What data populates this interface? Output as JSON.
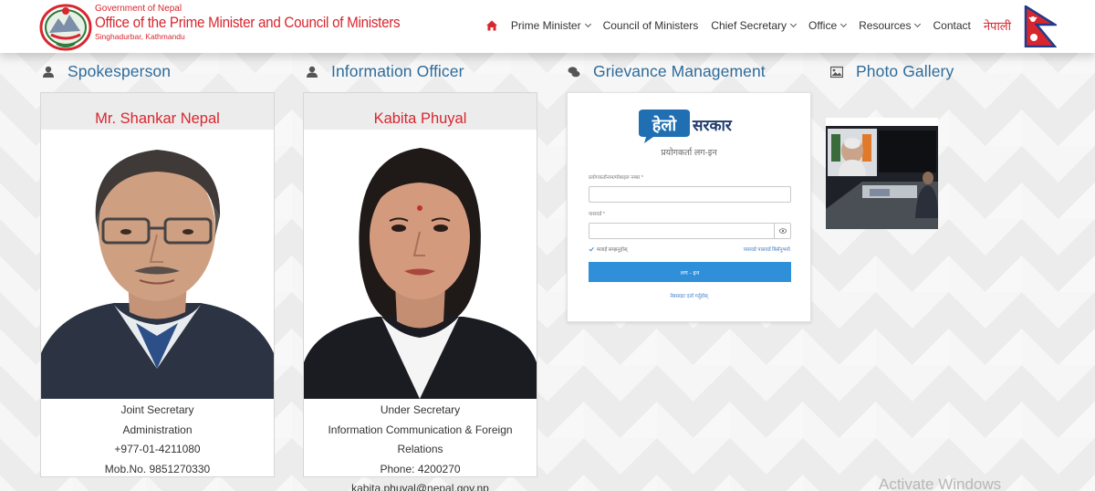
{
  "header": {
    "gov_label": "Government of Nepal",
    "office_title": "Office of the Prime Minister and Council of Ministers",
    "location": "Singhadurbar, Kathmandu",
    "nav": [
      {
        "label": "Prime Minister",
        "dropdown": true
      },
      {
        "label": "Council of Ministers",
        "dropdown": false
      },
      {
        "label": "Chief Secretary",
        "dropdown": true
      },
      {
        "label": "Office",
        "dropdown": true
      },
      {
        "label": "Resources",
        "dropdown": true
      },
      {
        "label": "Contact",
        "dropdown": false
      }
    ],
    "language_toggle": "नेपाली",
    "icons": {
      "home": "home-icon",
      "emblem": "nepal-emblem-logo",
      "flag": "nepal-flag"
    }
  },
  "sections": {
    "spokesperson": "Spokesperson",
    "information_officer": "Information Officer",
    "grievance": "Grievance Management",
    "gallery": "Photo Gallery"
  },
  "spokesperson": {
    "name": "Mr. Shankar Nepal",
    "position": "Joint Secretary",
    "division": "Administration",
    "phone": "+977-01-4211080",
    "mobile": "Mob.No. 9851270330"
  },
  "info_officer": {
    "name": "Kabita Phuyal",
    "position": "Under Secretary",
    "division": "Information Communication & Foreign Relations",
    "phone": "Phone: 4200270",
    "email": "kabita.phuyal@nepal.gov.np"
  },
  "grievance": {
    "logo_left": "हेलो",
    "logo_right": "सरकार",
    "subtitle": "प्रयोगकर्ता लग-इन",
    "username_label": "प्रयोगकर्तानाम/मोबाइल नम्बर *",
    "password_label": "पासवर्ड *",
    "remember_label": "मलाई सम्झनुहोस्",
    "forgot_label": "पासवर्ड पासवर्ड बिर्सनुभयो",
    "login_button": "लग - इन",
    "register_label": "नेबसाइट दर्ता गर्नुहोस्",
    "accent": "#2f8fd8"
  },
  "watermark": "Activate Windows",
  "colors": {
    "brand_red": "#d8262e",
    "section_blue": "#2e6b9a"
  }
}
